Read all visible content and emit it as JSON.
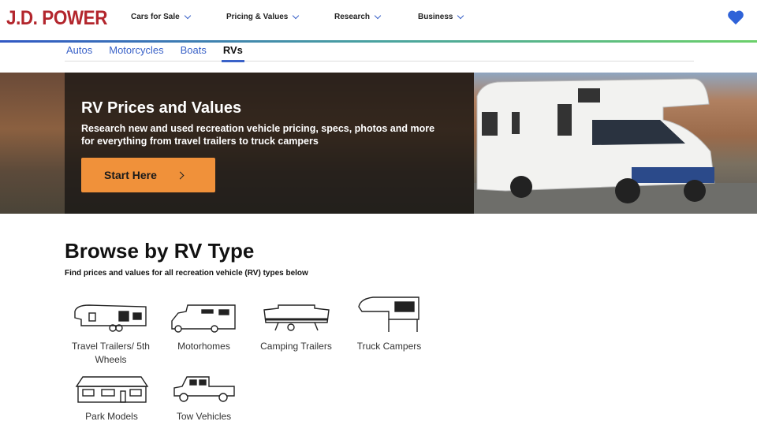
{
  "header": {
    "logo": "J.D. POWER",
    "nav": [
      "Cars for Sale",
      "Pricing & Values",
      "Research",
      "Business"
    ],
    "favorites_icon": "heart-icon",
    "accent": "#3a62c8",
    "logo_color": "#b3262d"
  },
  "tabs": [
    {
      "label": "Autos"
    },
    {
      "label": "Motorcycles"
    },
    {
      "label": "Boats"
    },
    {
      "label": "RVs",
      "active": true
    }
  ],
  "hero": {
    "title": "RV Prices and Values",
    "subtitle": "Research new and used recreation vehicle pricing, specs, photos and more for everything from travel trailers to truck campers",
    "button": "Start Here",
    "button_color": "#f0913a"
  },
  "browse": {
    "title": "Browse by RV Type",
    "subtitle": "Find prices and values for all recreation vehicle (RV) types below",
    "types": [
      {
        "label": "Travel Trailers/ 5th Wheels",
        "icon": "fifth-wheel-icon"
      },
      {
        "label": "Motorhomes",
        "icon": "motorhome-icon"
      },
      {
        "label": "Camping Trailers",
        "icon": "camping-trailer-icon"
      },
      {
        "label": "Truck Campers",
        "icon": "truck-camper-icon"
      },
      {
        "label": "Park Models",
        "icon": "park-model-icon"
      },
      {
        "label": "Tow Vehicles",
        "icon": "tow-vehicle-icon"
      }
    ]
  }
}
